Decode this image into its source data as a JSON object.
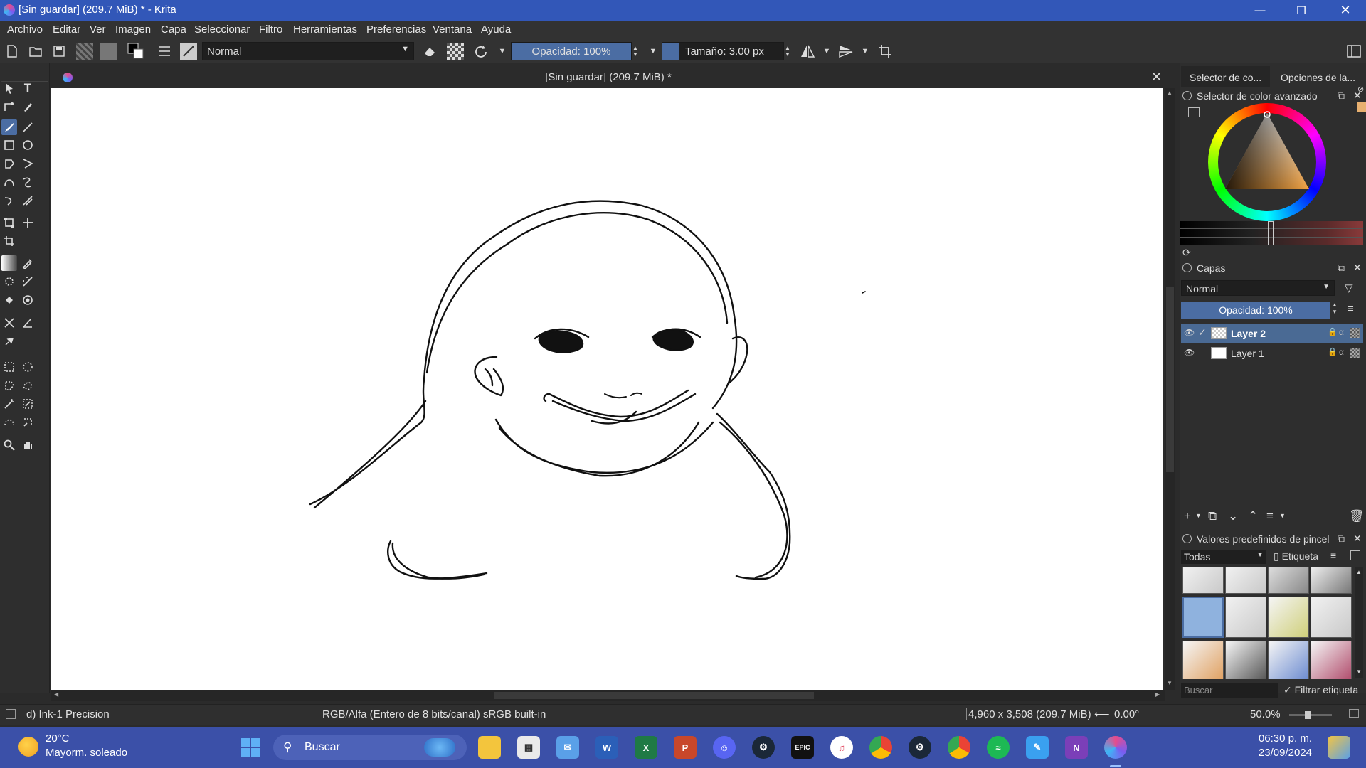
{
  "window": {
    "title": "[Sin guardar]  (209.7 MiB) * - Krita"
  },
  "menu": [
    "Archivo",
    "Editar",
    "Ver",
    "Imagen",
    "Capa",
    "Seleccionar",
    "Filtro",
    "Herramientas",
    "Preferencias",
    "Ventana",
    "Ayuda"
  ],
  "toolbar": {
    "blend_mode": "Normal",
    "opacity": "Opacidad: 100%",
    "size": "Tamaño: 3.00 px"
  },
  "document": {
    "tab_title": "[Sin guardar]  (209.7 MiB) *"
  },
  "dock": {
    "tabs": [
      "Selector de co...",
      "Opciones de la..."
    ],
    "color_panel_title": "Selector de color avanzado",
    "layers_panel_title": "Capas",
    "layer_blend_mode": "Normal",
    "layer_opacity": "Opacidad:  100%",
    "layers": [
      {
        "name": "Layer 2",
        "active": true
      },
      {
        "name": "Layer 1",
        "active": false
      }
    ],
    "presets_panel_title": "Valores predefinidos de pincel",
    "presets_filter": "Todas",
    "presets_tag": "Etiqueta",
    "search_placeholder": "Buscar",
    "filter_tag_label": "Filtrar etiqueta"
  },
  "status": {
    "brush": "d) Ink-1 Precision",
    "color_model": "RGB/Alfa (Entero de 8 bits/canal)  sRGB built-in",
    "dimensions": "4,960 x 3,508 (209.7 MiB)",
    "rotation": "0.00°",
    "zoom": "50.0%"
  },
  "taskbar": {
    "weather_temp": "20°C",
    "weather_desc": "Mayorm. soleado",
    "search": "Buscar",
    "time": "06:30 p. m.",
    "date": "23/09/2024"
  },
  "colors": {
    "titlebar": "#3257b8",
    "taskbar": "#3b50a8",
    "active_layer": "#4a6a94",
    "opacity_slider": "#4b6da3"
  }
}
